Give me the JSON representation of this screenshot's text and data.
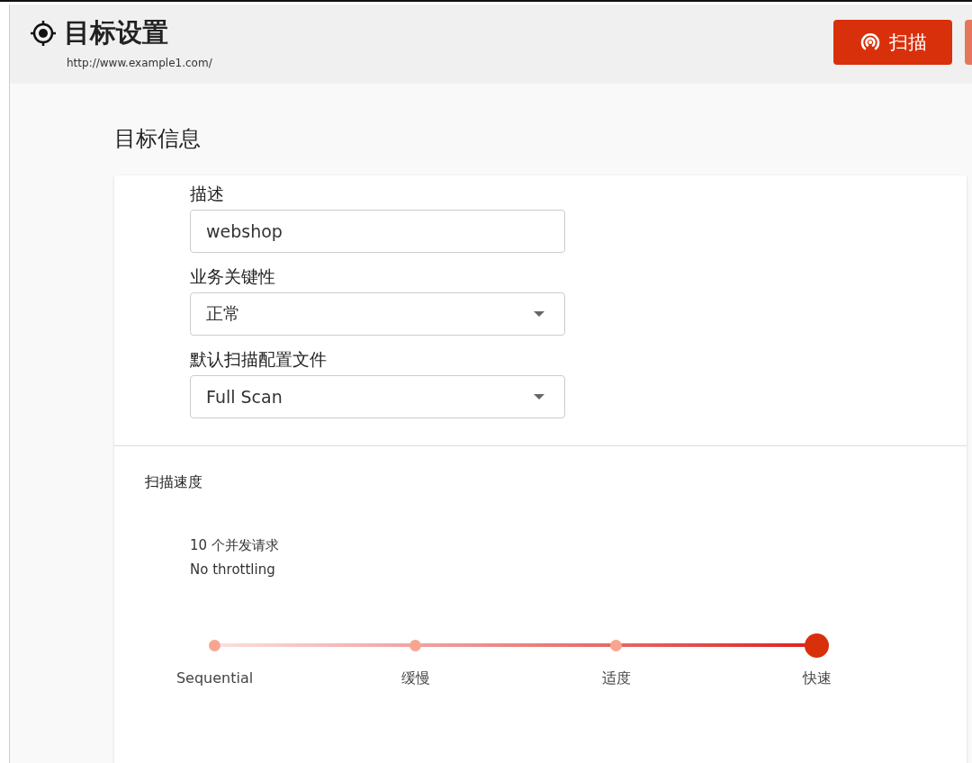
{
  "header": {
    "title": "目标设置",
    "url": "http://www.example1.com/"
  },
  "buttons": [
    {
      "label": "扫描",
      "kind": "primary"
    },
    {
      "kind": "partial"
    }
  ],
  "section_title": "目标信息",
  "fields": [
    {
      "label": "描述",
      "value": "webshop",
      "kind": "text"
    },
    {
      "label": "业务关键性",
      "value": "正常",
      "kind": "select"
    },
    {
      "label": "默认扫描配置文件",
      "value": "Full Scan",
      "kind": "select"
    }
  ],
  "speed": {
    "label": "扫描速度",
    "line_1": "10 个并发请求",
    "line_2": "No throttling",
    "level": 1,
    "stops": [
      {
        "label": "Sequential",
        "selected": false
      },
      {
        "label": "缓慢",
        "selected": false
      },
      {
        "label": "适度",
        "selected": false
      },
      {
        "label": "快速",
        "selected": true
      }
    ]
  }
}
